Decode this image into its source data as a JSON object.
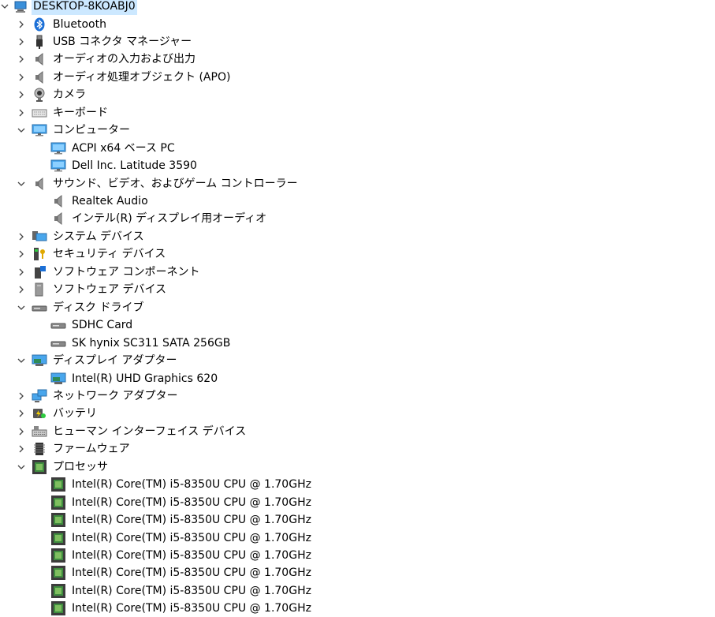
{
  "colors": {
    "selection": "#cce8ff",
    "chevron": "#444444"
  },
  "root": {
    "label": "DESKTOP-8KOABJ0",
    "icon": "computer-icon",
    "expanded": true
  },
  "items": [
    {
      "label": "Bluetooth",
      "icon": "bluetooth-icon",
      "level": 1,
      "expanded": false
    },
    {
      "label": "USB コネクタ マネージャー",
      "icon": "usb-icon",
      "level": 1,
      "expanded": false
    },
    {
      "label": "オーディオの入力および出力",
      "icon": "speaker-icon",
      "level": 1,
      "expanded": false
    },
    {
      "label": "オーディオ処理オブジェクト (APO)",
      "icon": "speaker-icon",
      "level": 1,
      "expanded": false
    },
    {
      "label": "カメラ",
      "icon": "camera-icon",
      "level": 1,
      "expanded": false
    },
    {
      "label": "キーボード",
      "icon": "keyboard-icon",
      "level": 1,
      "expanded": false
    },
    {
      "label": "コンピューター",
      "icon": "monitor-icon",
      "level": 1,
      "expanded": true
    },
    {
      "label": "ACPI x64 ベース PC",
      "icon": "monitor-icon",
      "level": 2
    },
    {
      "label": "Dell Inc. Latitude 3590",
      "icon": "monitor-icon",
      "level": 2
    },
    {
      "label": "サウンド、ビデオ、およびゲーム コントローラー",
      "icon": "speaker-icon",
      "level": 1,
      "expanded": true
    },
    {
      "label": "Realtek Audio",
      "icon": "speaker-icon",
      "level": 2
    },
    {
      "label": "インテル(R) ディスプレイ用オーディオ",
      "icon": "speaker-icon",
      "level": 2
    },
    {
      "label": "システム デバイス",
      "icon": "system-devices-icon",
      "level": 1,
      "expanded": false
    },
    {
      "label": "セキュリティ デバイス",
      "icon": "security-key-icon",
      "level": 1,
      "expanded": false
    },
    {
      "label": "ソフトウェア コンポーネント",
      "icon": "software-component-icon",
      "level": 1,
      "expanded": false
    },
    {
      "label": "ソフトウェア デバイス",
      "icon": "software-device-icon",
      "level": 1,
      "expanded": false
    },
    {
      "label": "ディスク ドライブ",
      "icon": "disk-drive-icon",
      "level": 1,
      "expanded": true
    },
    {
      "label": "SDHC Card",
      "icon": "disk-drive-icon",
      "level": 2
    },
    {
      "label": "SK hynix SC311 SATA 256GB",
      "icon": "disk-drive-icon",
      "level": 2
    },
    {
      "label": "ディスプレイ アダプター",
      "icon": "display-adapter-icon",
      "level": 1,
      "expanded": true
    },
    {
      "label": "Intel(R) UHD Graphics 620",
      "icon": "display-adapter-icon",
      "level": 2
    },
    {
      "label": "ネットワーク アダプター",
      "icon": "network-adapter-icon",
      "level": 1,
      "expanded": false
    },
    {
      "label": "バッテリ",
      "icon": "battery-icon",
      "level": 1,
      "expanded": false
    },
    {
      "label": "ヒューマン インターフェイス デバイス",
      "icon": "hid-icon",
      "level": 1,
      "expanded": false
    },
    {
      "label": "ファームウェア",
      "icon": "firmware-icon",
      "level": 1,
      "expanded": false
    },
    {
      "label": "プロセッサ",
      "icon": "processor-icon",
      "level": 1,
      "expanded": true
    },
    {
      "label": "Intel(R) Core(TM) i5-8350U CPU @ 1.70GHz",
      "icon": "processor-icon",
      "level": 2
    },
    {
      "label": "Intel(R) Core(TM) i5-8350U CPU @ 1.70GHz",
      "icon": "processor-icon",
      "level": 2
    },
    {
      "label": "Intel(R) Core(TM) i5-8350U CPU @ 1.70GHz",
      "icon": "processor-icon",
      "level": 2
    },
    {
      "label": "Intel(R) Core(TM) i5-8350U CPU @ 1.70GHz",
      "icon": "processor-icon",
      "level": 2
    },
    {
      "label": "Intel(R) Core(TM) i5-8350U CPU @ 1.70GHz",
      "icon": "processor-icon",
      "level": 2
    },
    {
      "label": "Intel(R) Core(TM) i5-8350U CPU @ 1.70GHz",
      "icon": "processor-icon",
      "level": 2
    },
    {
      "label": "Intel(R) Core(TM) i5-8350U CPU @ 1.70GHz",
      "icon": "processor-icon",
      "level": 2
    },
    {
      "label": "Intel(R) Core(TM) i5-8350U CPU @ 1.70GHz",
      "icon": "processor-icon",
      "level": 2
    }
  ]
}
